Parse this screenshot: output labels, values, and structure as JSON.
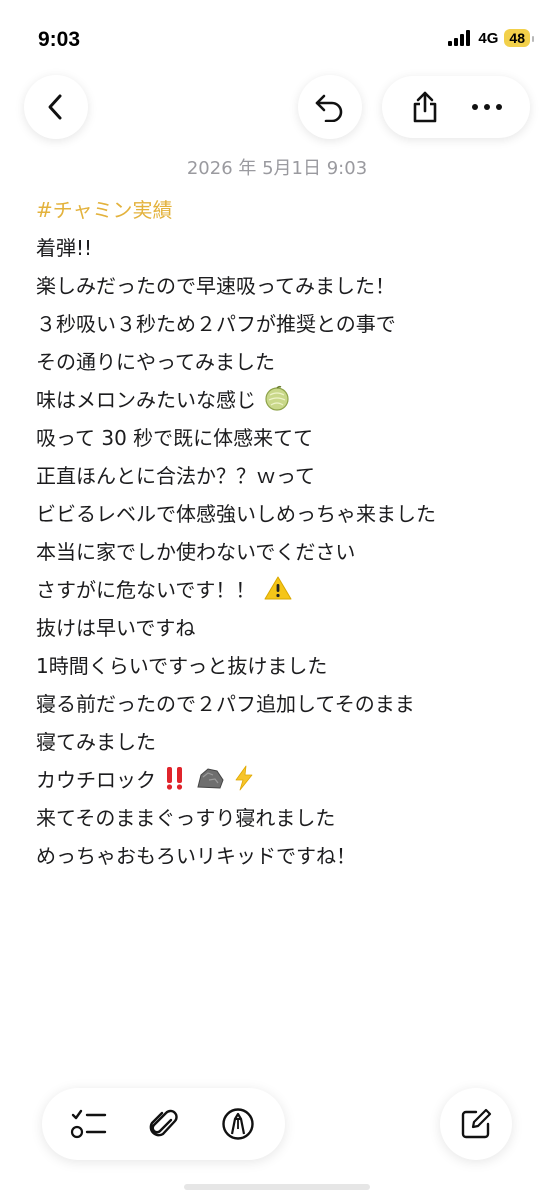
{
  "status_bar": {
    "time": "9:03",
    "network": "4G",
    "battery": "48"
  },
  "toolbar": {
    "back_icon": "chevron-left-icon",
    "undo_icon": "undo-icon",
    "share_icon": "share-icon",
    "more_icon": "more-icon"
  },
  "note": {
    "date": "2026 年 5月1日 9:03",
    "lines": [
      "#チャミン実績",
      "着弾!!",
      "楽しみだったので早速吸ってみました！",
      "３秒吸い３秒ため２パフが推奨との事で",
      "その通りにやってみました",
      "味はメロンみたいな感じ",
      "吸って 30 秒で既に体感来てて",
      "正直ほんとに合法か？？ｗって",
      "ビビるレベルで体感強いしめっちゃ来ました",
      "本当に家でしか使わないでください",
      "さすがに危ないです！！",
      "抜けは早いですね",
      "1時間くらいですっと抜けました",
      "寝る前だったので２パフ追加してそのまま",
      "寝てみました",
      "カウチロック",
      "来てそのままぐっすり寝れました",
      "めっちゃおもろいリキッドですね！"
    ]
  },
  "bottom_bar": {
    "checklist_icon": "checklist-icon",
    "attachment_icon": "paperclip-icon",
    "markup_icon": "markup-pen-icon",
    "compose_icon": "compose-icon"
  },
  "colors": {
    "tag": "#e3b23c",
    "text": "#1c1c1e",
    "date": "#9a9a9f",
    "battery": "#f2d04a"
  }
}
